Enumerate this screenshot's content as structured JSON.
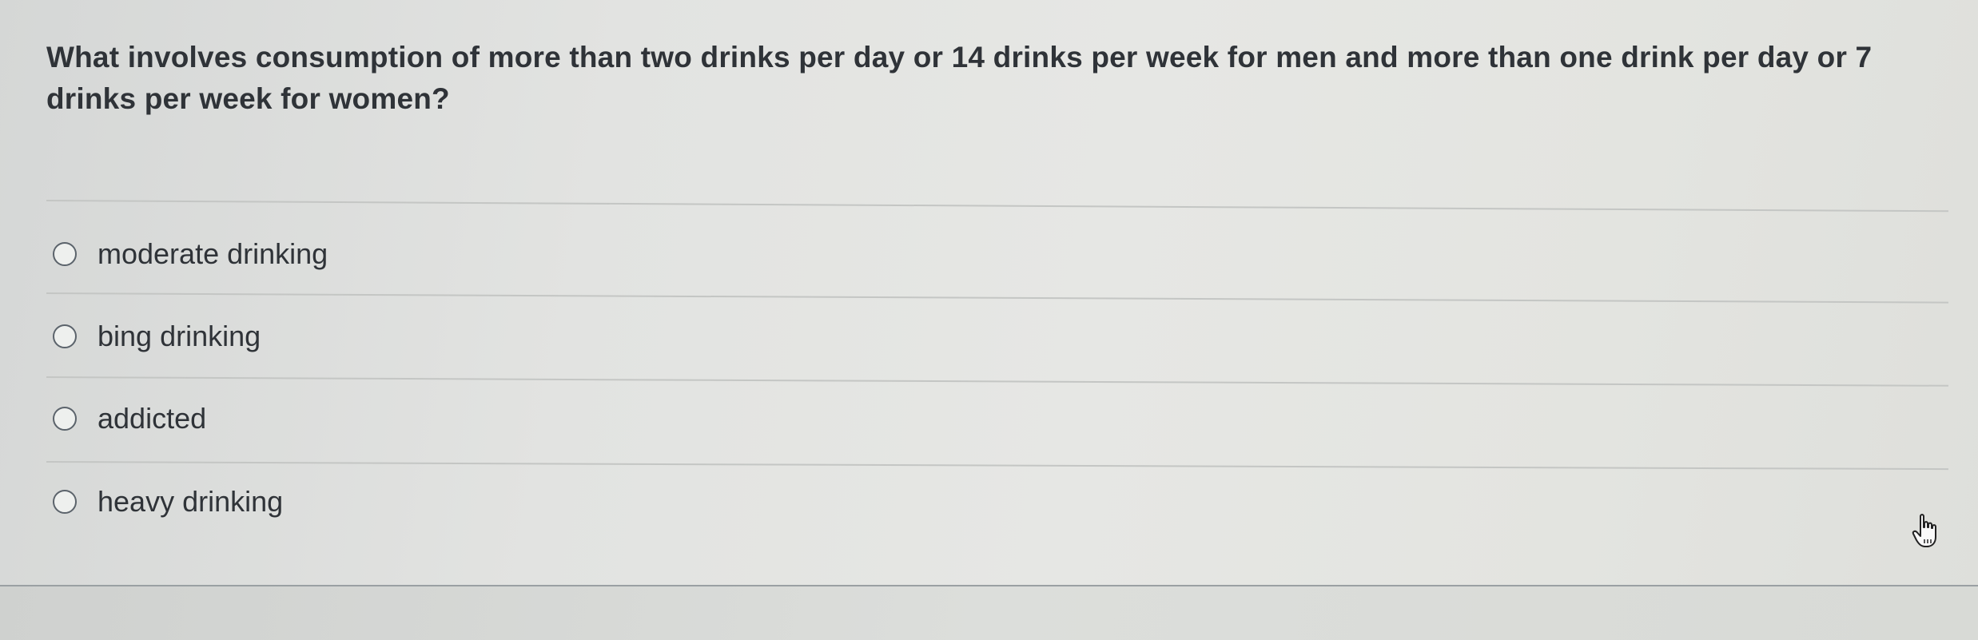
{
  "question": {
    "text": "What involves consumption of more than two drinks per day or 14 drinks per week for men and more than one drink per day or 7 drinks per week for women?"
  },
  "answers": [
    {
      "label": "moderate drinking",
      "selected": false
    },
    {
      "label": "bing drinking",
      "selected": false
    },
    {
      "label": "addicted",
      "selected": false
    },
    {
      "label": "heavy drinking",
      "selected": false
    }
  ],
  "cursor": {
    "icon": "hand-pointer-icon"
  },
  "colors": {
    "text": "#2f3338",
    "divider": "#c4c6c4",
    "radio_border": "#5b636b"
  }
}
